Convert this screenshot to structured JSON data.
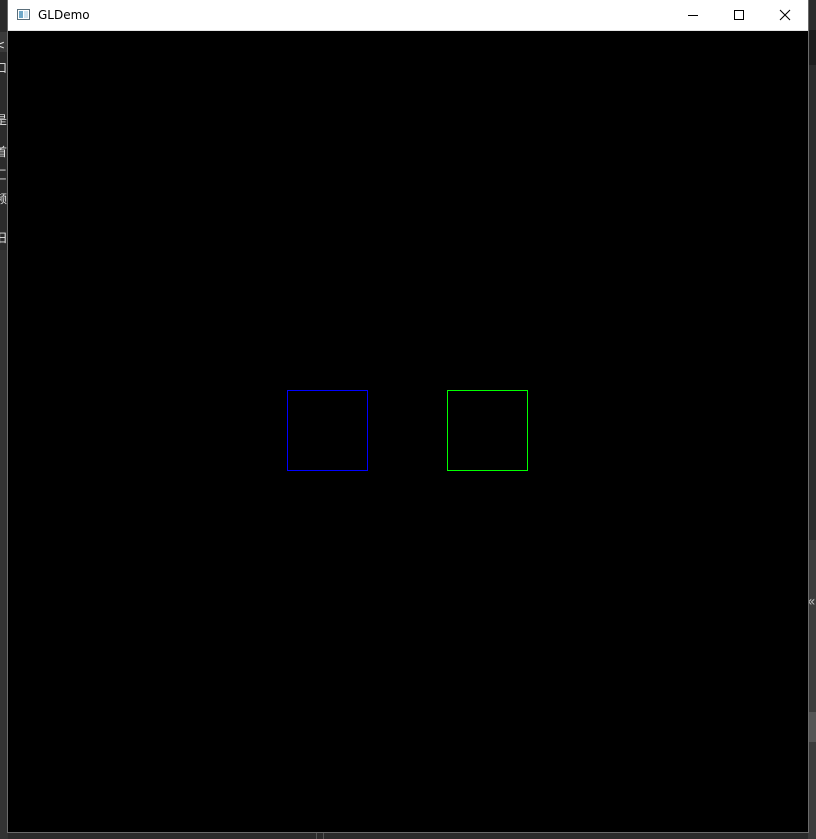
{
  "window": {
    "title": "GLDemo",
    "app_icon": "application-window-icon",
    "caption_buttons": {
      "minimize_icon": "minimize-icon",
      "maximize_icon": "maximize-icon",
      "close_icon": "close-icon"
    }
  },
  "scene": {
    "background_color": "#000000",
    "squares": [
      {
        "name": "blue-square-outline",
        "stroke_color": "#0000ff"
      },
      {
        "name": "green-square-outline",
        "stroke_color": "#00ff00"
      }
    ]
  },
  "background_app": {
    "left_glyphs": [
      "<",
      "口",
      "-",
      "是",
      "首",
      "匚",
      "频",
      "旧"
    ],
    "right_chevron": "«"
  }
}
